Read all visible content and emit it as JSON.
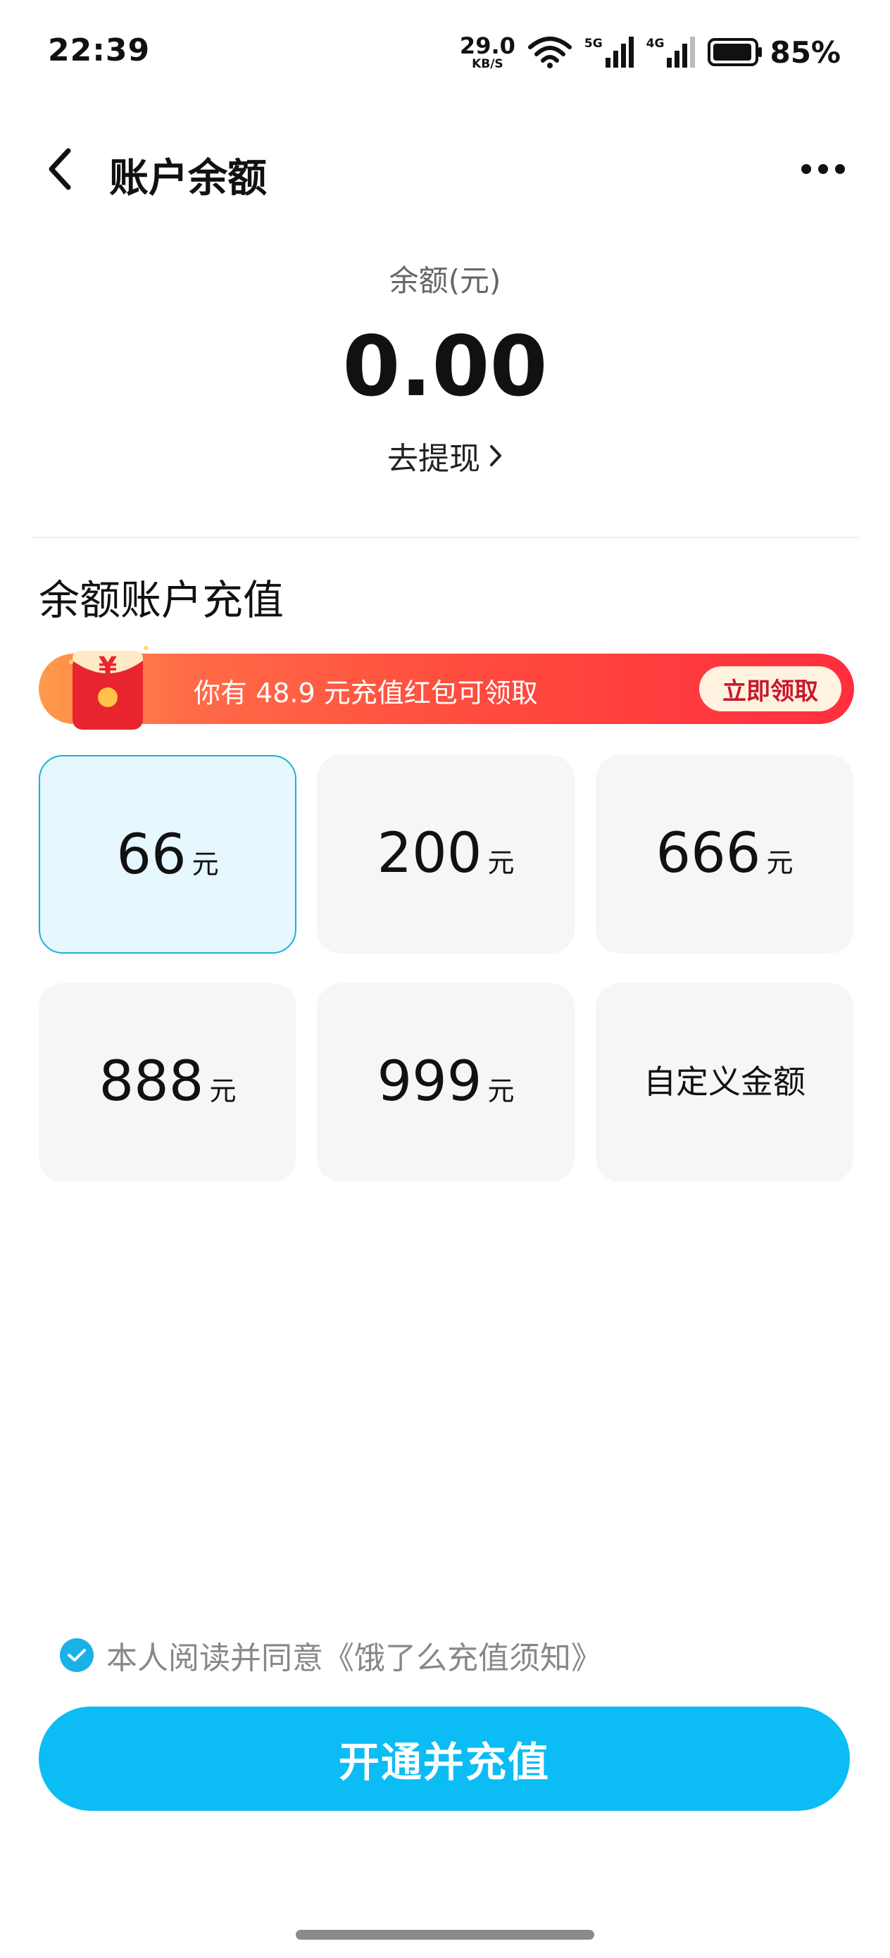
{
  "status_bar": {
    "time": "22:39",
    "net_speed_value": "29.0",
    "net_speed_unit": "KB/S",
    "signal1_tag": "5G",
    "signal2_tag": "4G",
    "battery_percent": "85%"
  },
  "header": {
    "title": "账户余额",
    "back_icon": "chevron-left-icon",
    "more_icon": "more-dots-icon"
  },
  "balance": {
    "label": "余额(元)",
    "value": "0.00",
    "withdraw_label": "去提现"
  },
  "recharge": {
    "section_title": "余额账户充值",
    "promo": {
      "text": "你有 48.9 元充值红包可领取",
      "button_label": "立即领取",
      "envelope_symbol": "¥"
    },
    "unit": "元",
    "amounts": [
      {
        "value": "66",
        "selected": true
      },
      {
        "value": "200",
        "selected": false
      },
      {
        "value": "666",
        "selected": false
      },
      {
        "value": "888",
        "selected": false
      },
      {
        "value": "999",
        "selected": false
      }
    ],
    "custom_label": "自定义金额"
  },
  "agreement": {
    "checked": true,
    "text": "本人阅读并同意《饿了么充值须知》"
  },
  "action": {
    "button_label": "开通并充值"
  },
  "colors": {
    "accent": "#0bbcf5",
    "selected_border": "#1bb0dc",
    "selected_bg": "#e6f7fd",
    "promo_red": "#ff2e3e",
    "promo_button_text": "#c9172c"
  }
}
